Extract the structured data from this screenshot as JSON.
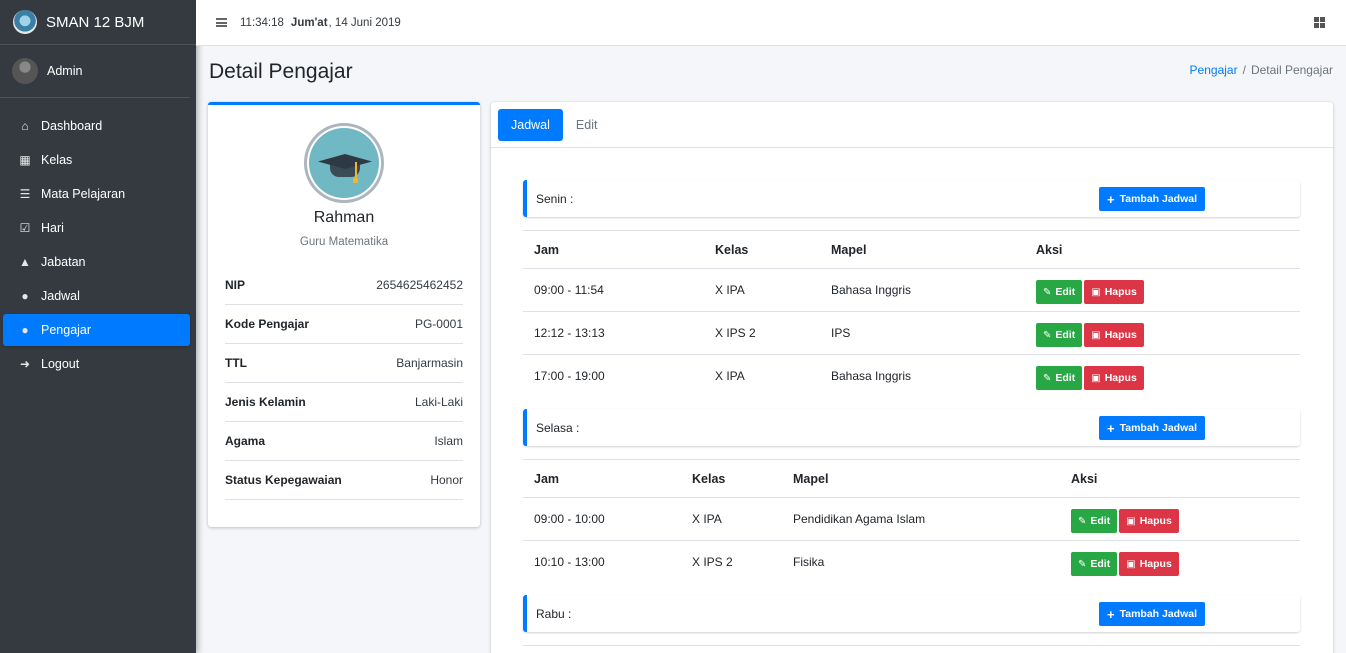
{
  "brand": {
    "name": "SMAN 12 BJM"
  },
  "user": {
    "name": "Admin"
  },
  "sidebar": {
    "items": [
      {
        "label": "Dashboard",
        "icon": "home-icon"
      },
      {
        "label": "Kelas",
        "icon": "cubes-icon"
      },
      {
        "label": "Mata Pelajaran",
        "icon": "list-icon"
      },
      {
        "label": "Hari",
        "icon": "calendar-icon"
      },
      {
        "label": "Jabatan",
        "icon": "sitemap-icon"
      },
      {
        "label": "Jadwal",
        "icon": "user-icon"
      },
      {
        "label": "Pengajar",
        "icon": "users-icon",
        "active": true
      },
      {
        "label": "Logout",
        "icon": "sign-out-icon"
      }
    ]
  },
  "topbar": {
    "time": "11:34:18",
    "day": "Jum'at",
    "date": ", 14 Juni 2019"
  },
  "page": {
    "title": "Detail Pengajar"
  },
  "breadcrumb": {
    "link": "Pengajar",
    "separator": "/",
    "current": "Detail Pengajar"
  },
  "profile": {
    "name": "Rahman",
    "role": "Guru Matematika",
    "fields": [
      {
        "label": "NIP",
        "value": "2654625462452"
      },
      {
        "label": "Kode Pengajar",
        "value": "PG-0001"
      },
      {
        "label": "TTL",
        "value": "Banjarmasin"
      },
      {
        "label": "Jenis Kelamin",
        "value": "Laki-Laki"
      },
      {
        "label": "Agama",
        "value": "Islam"
      },
      {
        "label": "Status Kepegawaian",
        "value": "Honor"
      }
    ]
  },
  "tabs": [
    {
      "label": "Jadwal",
      "active": true
    },
    {
      "label": "Edit"
    }
  ],
  "schedule": {
    "add_label": "Tambah Jadwal",
    "edit_label": "Edit",
    "delete_label": "Hapus",
    "headers": {
      "jam": "Jam",
      "kelas": "Kelas",
      "mapel": "Mapel",
      "aksi": "Aksi"
    },
    "days": [
      {
        "label": "Senin :",
        "rows": [
          {
            "jam": "09:00 - 11:54",
            "kelas": "X IPA",
            "mapel": "Bahasa Inggris"
          },
          {
            "jam": "12:12 - 13:13",
            "kelas": "X IPS 2",
            "mapel": "IPS"
          },
          {
            "jam": "17:00 - 19:00",
            "kelas": "X IPA",
            "mapel": "Bahasa Inggris"
          }
        ]
      },
      {
        "label": "Selasa :",
        "rows": [
          {
            "jam": "09:00 - 10:00",
            "kelas": "X IPA",
            "mapel": "Pendidikan Agama Islam"
          },
          {
            "jam": "10:10 - 13:00",
            "kelas": "X IPS 2",
            "mapel": "Fisika"
          }
        ]
      },
      {
        "label": "Rabu :",
        "rows": []
      }
    ]
  },
  "colors": {
    "primary": "#007bff",
    "success": "#28a745",
    "danger": "#dc3545",
    "sidebar": "#343a40"
  }
}
